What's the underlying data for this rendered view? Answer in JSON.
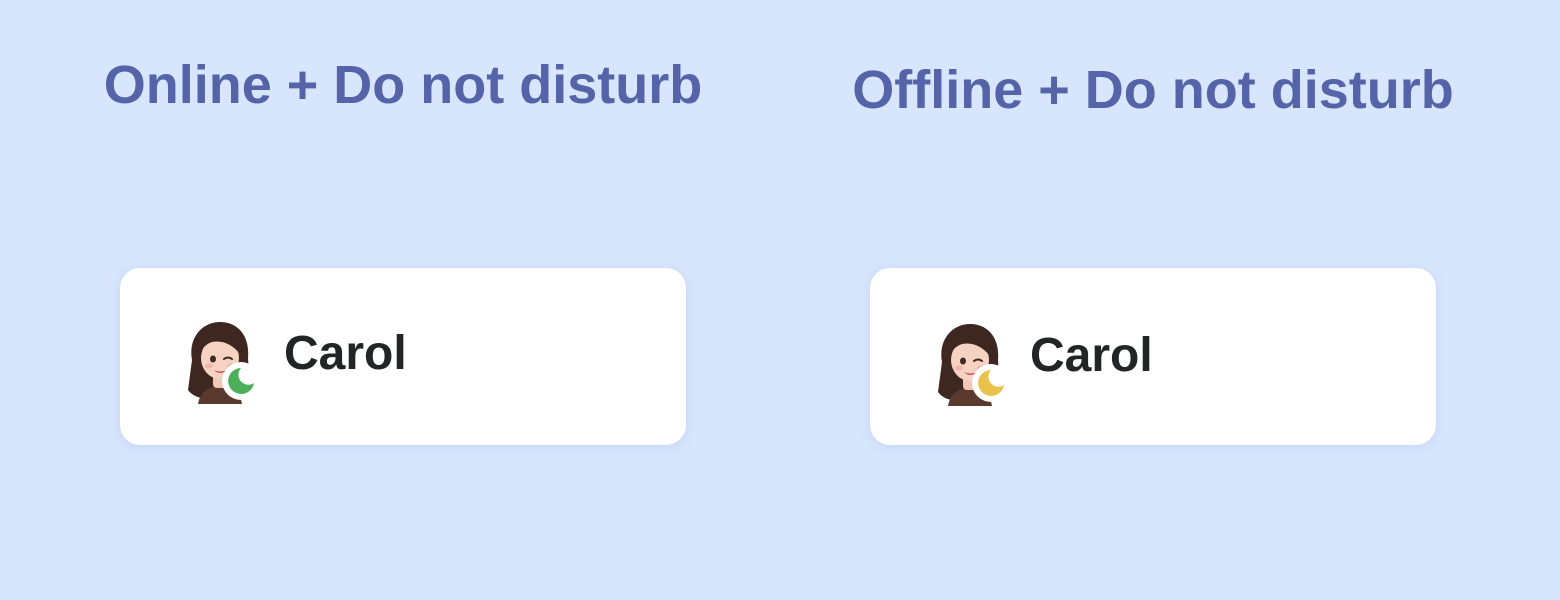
{
  "colors": {
    "background": "#d7e5fd",
    "heading": "#5563a8",
    "card": "#ffffff",
    "name_text": "#222426",
    "online_status": "#4caf5a",
    "offline_status": "#e8c24a"
  },
  "panels": [
    {
      "heading": "Online + Do not disturb",
      "user_name": "Carol",
      "status_icon": "moon-icon",
      "status": "online"
    },
    {
      "heading": "Offline + Do not disturb",
      "user_name": "Carol",
      "status_icon": "moon-icon",
      "status": "offline"
    }
  ]
}
